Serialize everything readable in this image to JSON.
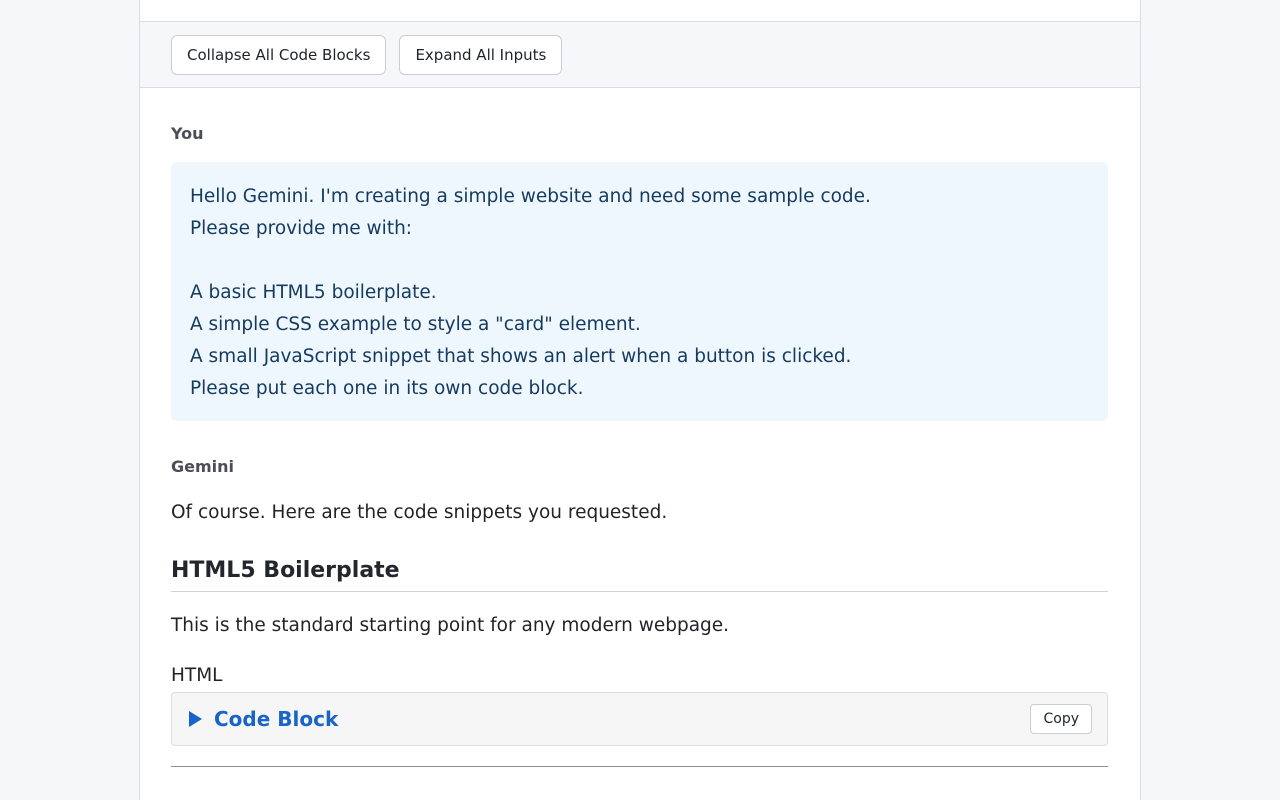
{
  "toolbar": {
    "collapse_label": "Collapse All Code Blocks",
    "expand_label": "Expand All Inputs"
  },
  "conversation": {
    "user": {
      "speaker": "You",
      "lines": [
        "Hello Gemini. I'm creating a simple website and need some sample code.",
        "Please provide me with:",
        "",
        "A basic HTML5 boilerplate.",
        "A simple CSS example to style a \"card\" element.",
        "A small JavaScript snippet that shows an alert when a button is clicked.",
        "Please put each one in its own code block."
      ]
    },
    "assistant": {
      "speaker": "Gemini",
      "intro": "Of course. Here are the code snippets you requested.",
      "section": {
        "title": "HTML5 Boilerplate",
        "description": "This is the standard starting point for any modern webpage.",
        "language": "HTML",
        "code_summary": "Code Block",
        "copy_label": "Copy"
      }
    }
  }
}
